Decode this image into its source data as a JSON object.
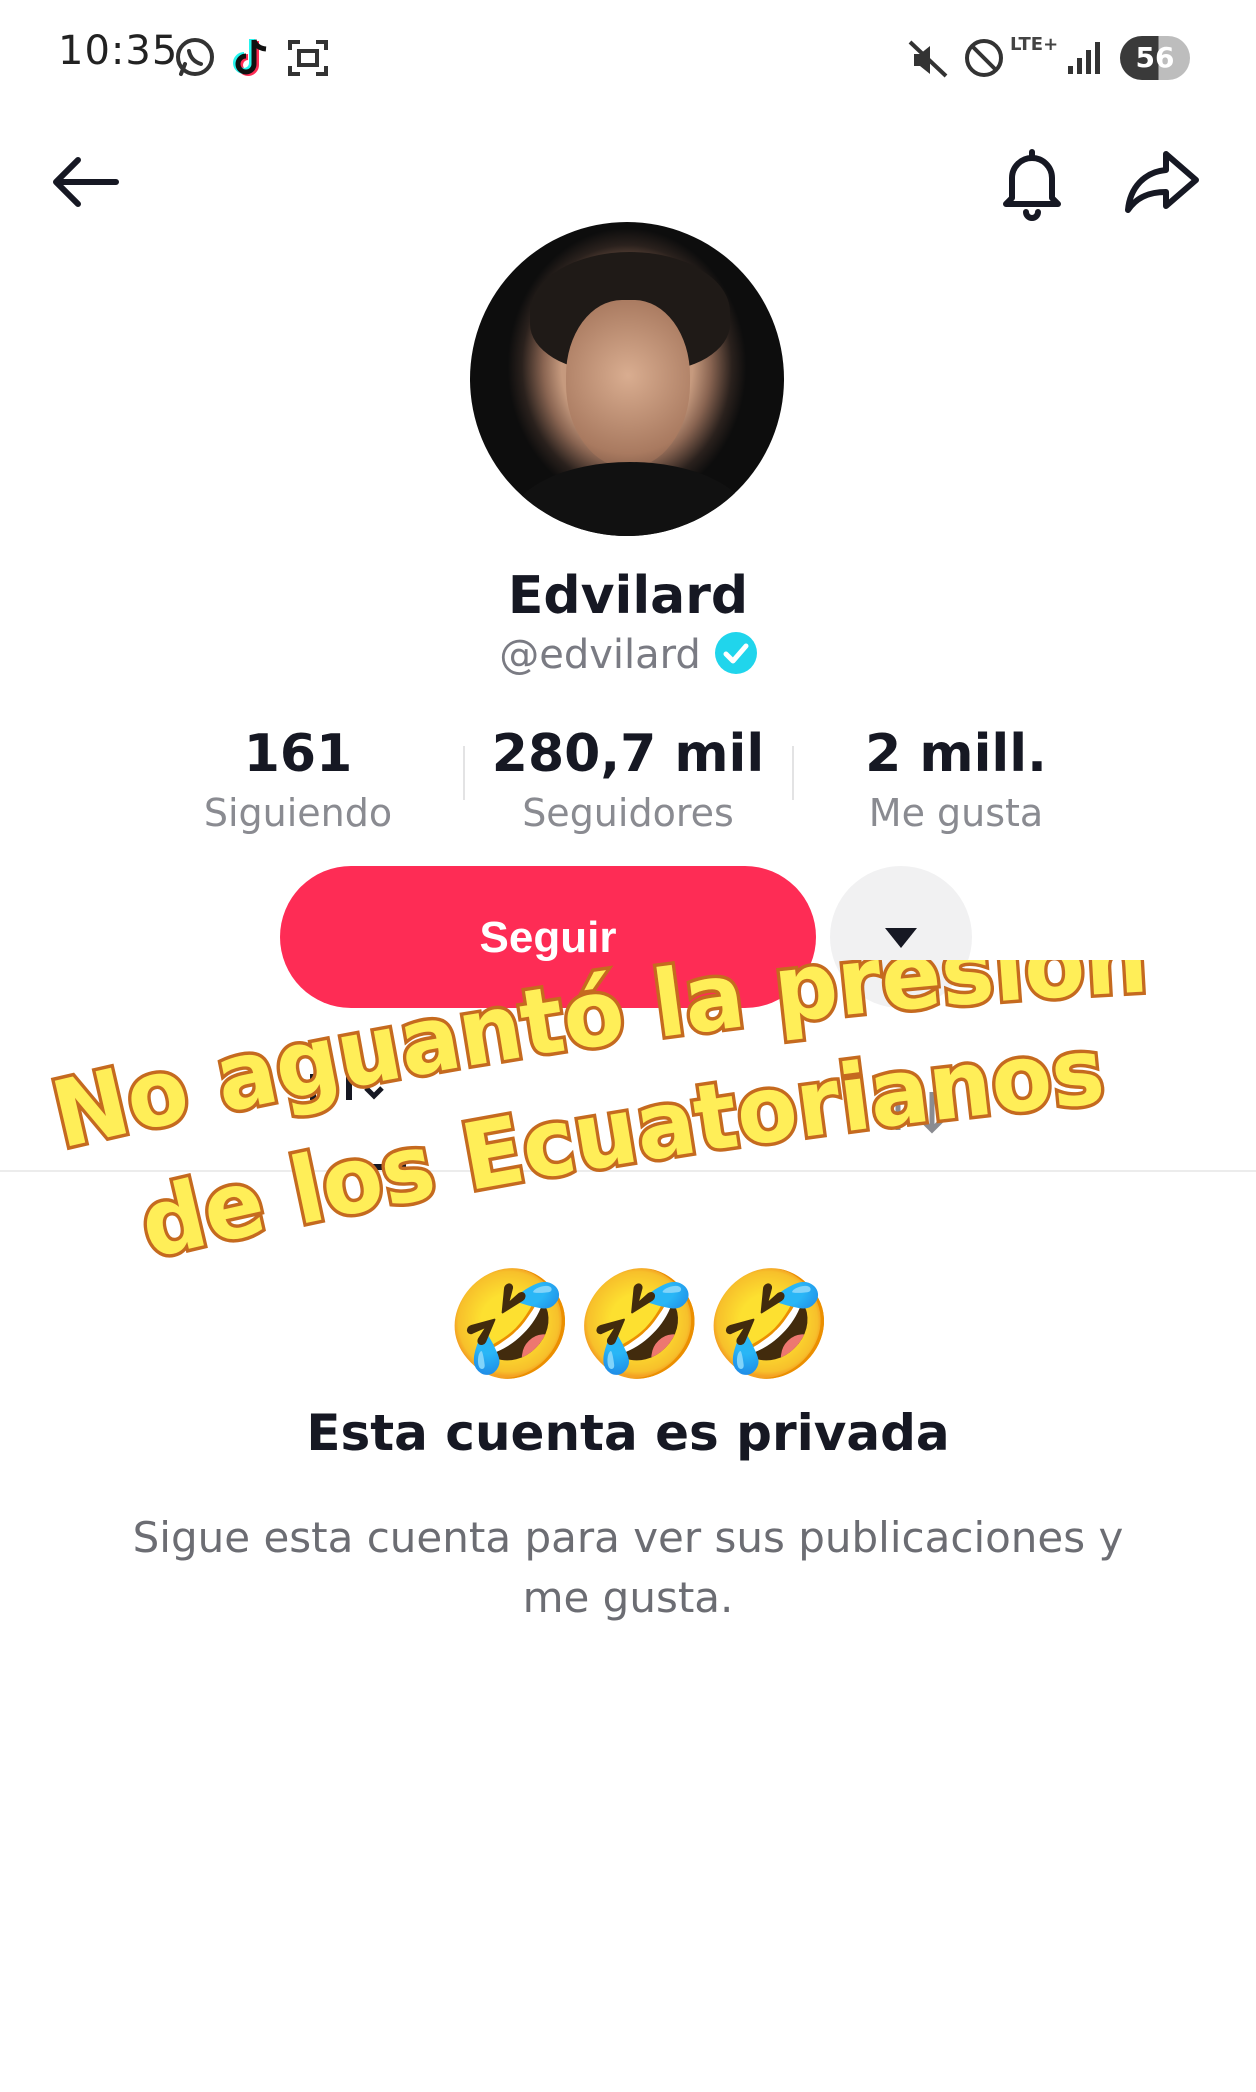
{
  "status_bar": {
    "time": "10:35",
    "network": "LTE+",
    "battery": "56",
    "icons": [
      "whatsapp-icon",
      "tiktok-icon",
      "screenshot-icon",
      "mute-icon",
      "do-not-disturb-icon",
      "signal-icon"
    ]
  },
  "nav": {
    "icons": [
      "back-arrow-icon",
      "bell-icon",
      "share-icon"
    ]
  },
  "profile": {
    "name": "Edvilard",
    "username": "@edvilard",
    "verified": true
  },
  "stats": [
    {
      "value": "161",
      "label": "Siguiendo"
    },
    {
      "value": "280,7 mil",
      "label": "Seguidores"
    },
    {
      "value": "2 mill.",
      "label": "Me gusta"
    }
  ],
  "actions": {
    "follow_label": "Seguir"
  },
  "overlay_caption": {
    "line1": "No aguantó la presión",
    "line2": "de los Ecuatorianos",
    "emoji": "🤣🤣🤣",
    "fill_color": "#ffee58",
    "outline_color": "#c56a1f"
  },
  "private_notice": {
    "title": "Esta cuenta es privada",
    "subtitle": "Sigue esta cuenta para ver sus publicaciones y me gusta."
  },
  "colors": {
    "accent": "#fe2c55",
    "verified": "#20d5ec"
  }
}
